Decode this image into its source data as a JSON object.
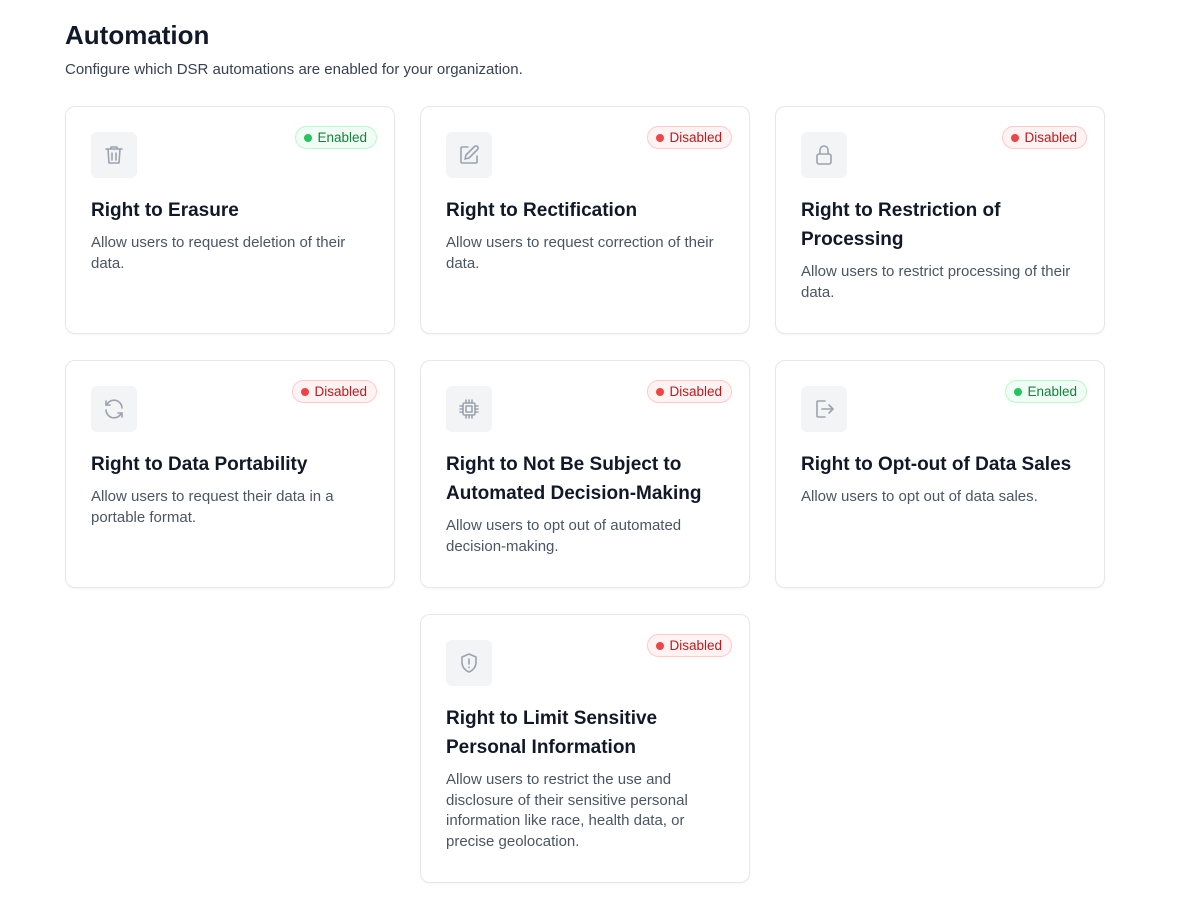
{
  "header": {
    "title": "Automation",
    "subtitle": "Configure which DSR automations are enabled for your organization."
  },
  "cards": [
    {
      "title": "Right to Erasure",
      "description": "Allow users to request deletion of their data.",
      "status": "Enabled",
      "icon": "trash-icon"
    },
    {
      "title": "Right to Rectification",
      "description": "Allow users to request correction of their data.",
      "status": "Disabled",
      "icon": "pencil-square-icon"
    },
    {
      "title": "Right to Restriction of Processing",
      "description": "Allow users to restrict processing of their data.",
      "status": "Disabled",
      "icon": "lock-icon"
    },
    {
      "title": "Right to Data Portability",
      "description": "Allow users to request their data in a portable format.",
      "status": "Disabled",
      "icon": "refresh-icon"
    },
    {
      "title": "Right to Not Be Subject to Automated Decision-Making",
      "description": "Allow users to opt out of automated decision-making.",
      "status": "Disabled",
      "icon": "cpu-chip-icon"
    },
    {
      "title": "Right to Opt-out of Data Sales",
      "description": "Allow users to opt out of data sales.",
      "status": "Enabled",
      "icon": "logout-icon"
    },
    {
      "title": "Right to Limit Sensitive Personal Information",
      "description": "Allow users to restrict the use and disclosure of their sensitive personal information like race, health data, or precise geolocation.",
      "status": "Disabled",
      "icon": "shield-exclamation-icon"
    }
  ],
  "colors": {
    "enabled_text": "#15803d",
    "enabled_dot": "#22c55e",
    "disabled_text": "#b91c1c",
    "disabled_dot": "#ef4444",
    "icon_gray": "#9ca3af"
  }
}
